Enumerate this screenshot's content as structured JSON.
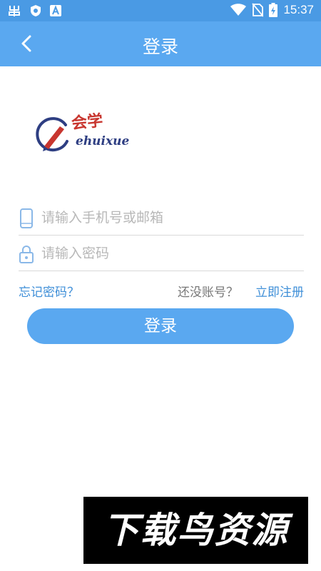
{
  "status_bar": {
    "time": "15:37",
    "icons": [
      "bug-icon",
      "shield-icon",
      "a-icon",
      "wifi-icon",
      "no-sim-icon",
      "battery-charging-icon"
    ]
  },
  "app_bar": {
    "title": "登录",
    "back_icon": "chevron-left-icon"
  },
  "logo": {
    "text_cn": "会学",
    "text_en": "ehuixue"
  },
  "form": {
    "phone_placeholder": "请输入手机号或邮箱",
    "phone_value": "",
    "password_placeholder": "请输入密码",
    "password_value": "",
    "forgot_label": "忘记密码？",
    "no_account_label": "还没账号？",
    "register_label": "立即注册",
    "login_button": "登录"
  },
  "watermark": {
    "text": "下载鸟资源"
  },
  "colors": {
    "primary": "#5aa8f0",
    "status_bar": "#4a9ae4",
    "link": "#3f8fd8",
    "brand_blue": "#2e3e82",
    "brand_red": "#c8362f"
  }
}
